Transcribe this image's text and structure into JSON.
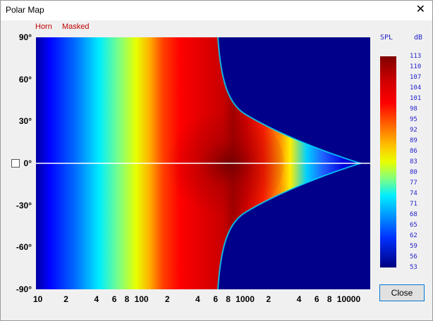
{
  "window": {
    "title": "Polar Map",
    "close_glyph": "✕"
  },
  "header": {
    "horn_label": "Horn",
    "masked_label": "Masked"
  },
  "chart_data": {
    "type": "heatmap",
    "x_scale": "log",
    "x_range": [
      10,
      20000
    ],
    "y_range": [
      -90,
      90
    ],
    "x_tick_labels": [
      "10",
      "2",
      "4",
      "6",
      "8",
      "100",
      "2",
      "4",
      "6",
      "8",
      "1000",
      "2",
      "4",
      "6",
      "8",
      "10000"
    ],
    "x_tick_values": [
      10,
      20,
      40,
      60,
      80,
      100,
      200,
      400,
      600,
      800,
      1000,
      2000,
      4000,
      6000,
      8000,
      10000
    ],
    "y_tick_labels": [
      "90°",
      "60°",
      "30°",
      "0°",
      "-30°",
      "-60°",
      "-90°"
    ],
    "y_tick_values": [
      90,
      60,
      30,
      0,
      -30,
      -60,
      -90
    ],
    "colorbar": {
      "title_left": "SPL",
      "title_right": "dB",
      "labels": [
        "113",
        "110",
        "107",
        "104",
        "101",
        "98",
        "95",
        "92",
        "89",
        "86",
        "83",
        "80",
        "77",
        "74",
        "71",
        "68",
        "65",
        "62",
        "59",
        "56",
        "53"
      ],
      "min": 53,
      "max": 113
    }
  },
  "buttons": {
    "close_label": "Close"
  },
  "colors": {
    "accent": "#0078d7",
    "label_blue": "#2222cc",
    "label_red": "#c00000",
    "background_navy": "#00008b"
  }
}
